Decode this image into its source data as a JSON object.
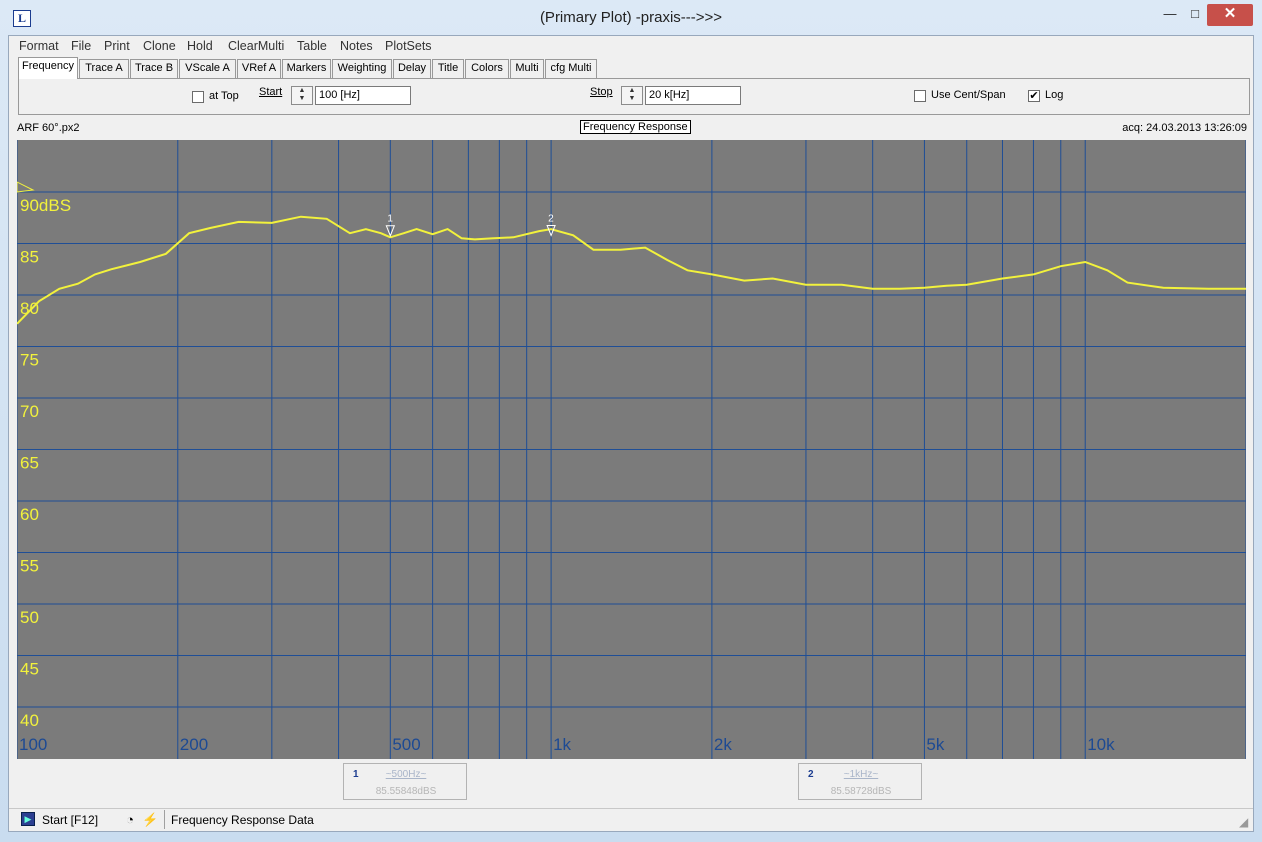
{
  "window": {
    "title": "(Primary Plot) -praxis--->>>",
    "app_icon": "L",
    "min_symbol": "—",
    "max_symbol": "□",
    "close_symbol": "✕"
  },
  "menu": [
    "Format",
    "File",
    "Print",
    "Clone",
    "Hold",
    "ClearMulti",
    "Table",
    "Notes",
    "PlotSets"
  ],
  "tabs": [
    "Frequency",
    "Trace A",
    "Trace B",
    "VScale A",
    "VRef A",
    "Markers",
    "Weighting",
    "Delay",
    "Title",
    "Colors",
    "Multi",
    "cfg Multi"
  ],
  "active_tab": "Frequency",
  "frequency_panel": {
    "at_top_label": "at Top",
    "at_top_checked": false,
    "start_label": "Start",
    "start_value": "100 [Hz]",
    "stop_label": "Stop",
    "stop_value": "20 k[Hz]",
    "use_cent_span_label": "Use Cent/Span",
    "use_cent_span_checked": false,
    "log_label": "Log",
    "log_checked": true,
    "check_mark": "✔"
  },
  "plot_header": {
    "name": "ARF 60°.px2",
    "title": "Frequency Response",
    "acq": "acq: 24.03.2013 13:26:09"
  },
  "chart_data": {
    "type": "line",
    "x_scale": "log",
    "xlim": [
      100,
      20000
    ],
    "ylim": [
      40,
      90
    ],
    "unit_label": "90dBS",
    "y_tick_labels": [
      "90dBS",
      "85",
      "80",
      "75",
      "70",
      "65",
      "60",
      "55",
      "50",
      "45",
      "40"
    ],
    "y_ticks": [
      90,
      85,
      80,
      75,
      70,
      65,
      60,
      55,
      50,
      45,
      40
    ],
    "x_tick_labels": [
      "100",
      "200",
      "500",
      "1k",
      "2k",
      "5k",
      "10k"
    ],
    "x_ticks": [
      100,
      200,
      500,
      1000,
      2000,
      5000,
      10000
    ],
    "grid": true,
    "background_color": "#7b7b7b",
    "grid_color": "#1f4e96",
    "trace_color": "#f2f23c",
    "series": [
      {
        "x": [
          100,
          110,
          120,
          130,
          140,
          150,
          170,
          190,
          210,
          230,
          260,
          300,
          340,
          380,
          420,
          450,
          480,
          500,
          530,
          560,
          600,
          640,
          680,
          720,
          780,
          850,
          950,
          1000,
          1100,
          1200,
          1350,
          1500,
          1650,
          1800,
          2000,
          2300,
          2600,
          3000,
          3500,
          4000,
          4500,
          5000,
          5500,
          6000,
          7000,
          8000,
          9000,
          10000,
          11000,
          12000,
          14000,
          17000,
          20000
        ],
        "y": [
          77.2,
          79.4,
          80.6,
          81.1,
          82.0,
          82.5,
          83.2,
          84.0,
          86.0,
          86.5,
          87.1,
          87.0,
          87.6,
          87.4,
          86.0,
          86.4,
          86.0,
          85.6,
          86.0,
          86.4,
          85.9,
          86.4,
          85.5,
          85.4,
          85.5,
          85.6,
          86.2,
          86.4,
          85.8,
          84.4,
          84.4,
          84.6,
          83.4,
          82.4,
          82.0,
          81.4,
          81.6,
          81.0,
          81.0,
          80.6,
          80.6,
          80.7,
          80.9,
          81.0,
          81.6,
          82.0,
          82.8,
          83.2,
          82.4,
          81.2,
          80.7,
          80.6,
          80.6
        ]
      }
    ],
    "markers": [
      {
        "label": "1",
        "x": 500,
        "y": 85.55848
      },
      {
        "label": "2",
        "x": 1000,
        "y": 85.58728
      }
    ]
  },
  "marker_readouts": [
    {
      "num": "1",
      "freq": "~500Hz~",
      "value": "85.55848dBS"
    },
    {
      "num": "2",
      "freq": "~1kHz~",
      "value": "85.58728dBS"
    }
  ],
  "status": {
    "start_label": "Start [F12]",
    "text": "Frequency Response Data",
    "icons": [
      "play-icon",
      "clock-icon",
      "signal-icon"
    ]
  }
}
